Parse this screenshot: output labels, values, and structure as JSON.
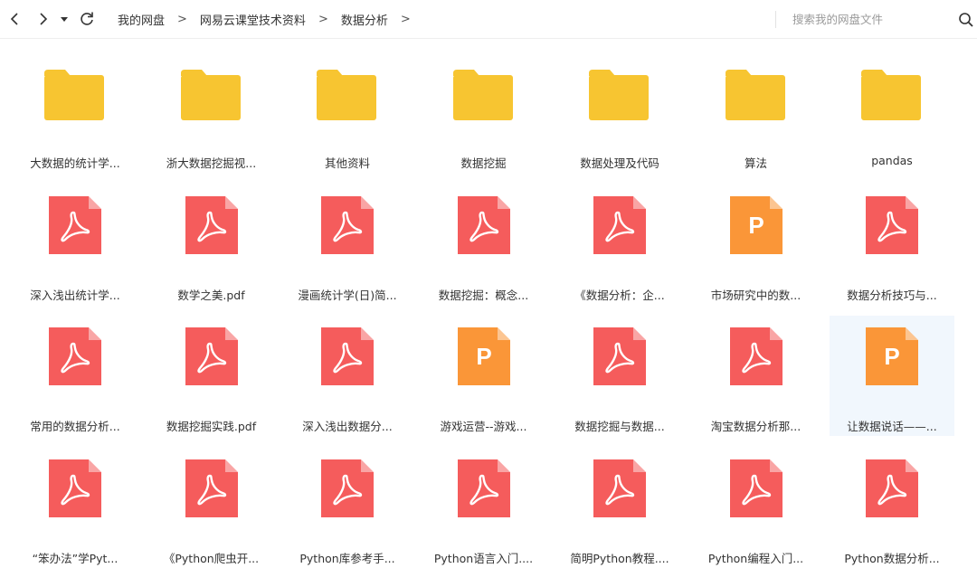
{
  "toolbar": {
    "breadcrumb": [
      "我的网盘",
      "网易云课堂技术资料",
      "数据分析"
    ],
    "separator": ">",
    "search_placeholder": "搜索我的网盘文件"
  },
  "colors": {
    "folder": "#f7c531",
    "pdf": "#f55c5c",
    "ppt": "#fa9638",
    "selected_bg": "#f1f7fd"
  },
  "files": [
    {
      "name": "大数据的统计学...",
      "type": "folder"
    },
    {
      "name": "浙大数据挖掘视...",
      "type": "folder"
    },
    {
      "name": "其他资料",
      "type": "folder"
    },
    {
      "name": "数据挖掘",
      "type": "folder"
    },
    {
      "name": "数据处理及代码",
      "type": "folder"
    },
    {
      "name": "算法",
      "type": "folder"
    },
    {
      "name": "pandas",
      "type": "folder"
    },
    {
      "name": "深入浅出统计学...",
      "type": "pdf"
    },
    {
      "name": "数学之美.pdf",
      "type": "pdf"
    },
    {
      "name": "漫画统计学(日)简...",
      "type": "pdf"
    },
    {
      "name": "数据挖掘：概念...",
      "type": "pdf"
    },
    {
      "name": "《数据分析：企...",
      "type": "pdf"
    },
    {
      "name": "市场研究中的数...",
      "type": "ppt",
      "letter": "P"
    },
    {
      "name": "数据分析技巧与...",
      "type": "pdf"
    },
    {
      "name": "常用的数据分析...",
      "type": "pdf"
    },
    {
      "name": "数据挖掘实践.pdf",
      "type": "pdf"
    },
    {
      "name": "深入浅出数据分...",
      "type": "pdf"
    },
    {
      "name": "游戏运营--游戏...",
      "type": "ppt",
      "letter": "P"
    },
    {
      "name": "数据挖掘与数据...",
      "type": "pdf"
    },
    {
      "name": "淘宝数据分析那...",
      "type": "pdf"
    },
    {
      "name": "让数据说话——...",
      "type": "ppt",
      "letter": "P",
      "selected": true
    },
    {
      "name": "“笨办法”学Pyt...",
      "type": "pdf"
    },
    {
      "name": "《Python爬虫开...",
      "type": "pdf"
    },
    {
      "name": "Python库参考手...",
      "type": "pdf"
    },
    {
      "name": "Python语言入门....",
      "type": "pdf"
    },
    {
      "name": "简明Python教程....",
      "type": "pdf"
    },
    {
      "name": "Python编程入门...",
      "type": "pdf"
    },
    {
      "name": "Python数据分析...",
      "type": "pdf"
    }
  ]
}
